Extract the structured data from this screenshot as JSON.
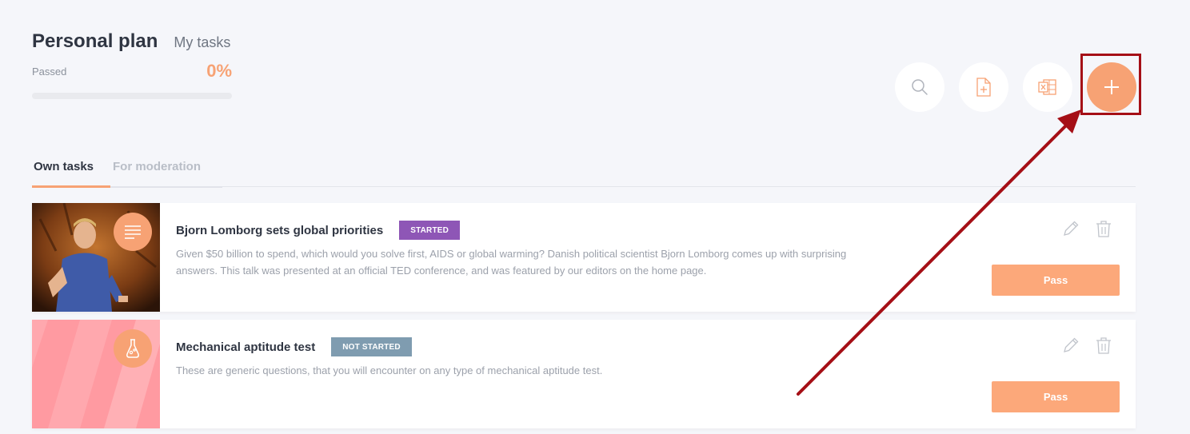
{
  "header": {
    "title": "Personal plan",
    "subtitle": "My tasks",
    "passed_label": "Passed",
    "passed_value": "0%",
    "progress_fraction": 0
  },
  "toolbar": {
    "search_icon": "search-icon",
    "import_icon": "file-add-icon",
    "excel_icon": "excel-icon",
    "add_icon": "plus-icon"
  },
  "tabs": [
    {
      "label": "Own tasks",
      "active": true
    },
    {
      "label": "For moderation",
      "active": false
    }
  ],
  "tasks": [
    {
      "title": "Bjorn Lomborg sets global priorities",
      "status": "STARTED",
      "status_color": "#8e56b6",
      "description": "Given $50 billion to spend, which would you solve first, AIDS or global warming? Danish political scientist Bjorn Lomborg comes up with surprising answers. This talk was presented at an official TED conference, and was featured by our editors on the home page.",
      "thumb_icon": "article-icon",
      "pass_label": "Pass"
    },
    {
      "title": "Mechanical aptitude test",
      "status": "NOT STARTED",
      "status_color": "#7f9cb0",
      "description": "These are generic questions, that you will encounter on any type of mechanical aptitude test.",
      "thumb_icon": "flask-icon",
      "pass_label": "Pass"
    }
  ],
  "colors": {
    "accent": "#f7a274",
    "annotation": "#a50f16"
  }
}
